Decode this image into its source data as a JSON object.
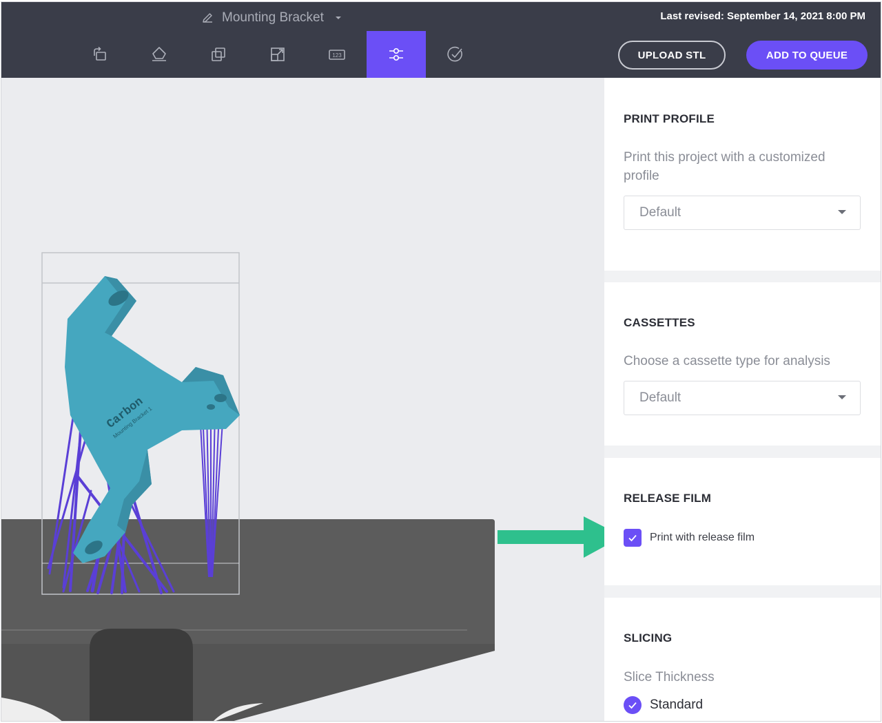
{
  "header": {
    "project_title": "Mounting Bracket",
    "last_revised": "Last revised: September 14, 2021 8:00 PM",
    "upload_label": "UPLOAD STL",
    "queue_label": "ADD TO QUEUE"
  },
  "toolbar": {
    "tools": [
      {
        "name": "orient-icon",
        "active": false
      },
      {
        "name": "platform-icon",
        "active": false
      },
      {
        "name": "duplicate-icon",
        "active": false
      },
      {
        "name": "scale-icon",
        "active": false
      },
      {
        "name": "numbering-icon",
        "active": false,
        "text": "123"
      },
      {
        "name": "settings-sliders-icon",
        "active": true
      },
      {
        "name": "check-circle-icon",
        "active": false
      }
    ]
  },
  "viewport": {
    "part_label": "Carbon",
    "part_sublabel": "Mounting Bracket 1"
  },
  "panel": {
    "print_profile": {
      "title": "PRINT PROFILE",
      "description": "Print this project with a customized profile",
      "selected": "Default"
    },
    "cassettes": {
      "title": "CASSETTES",
      "description": "Choose a cassette type for analysis",
      "selected": "Default"
    },
    "release_film": {
      "title": "RELEASE FILM",
      "checkbox_label": "Print with release film",
      "checked": true
    },
    "slicing": {
      "title": "SLICING",
      "subtitle": "Slice Thickness",
      "option_label": "Standard",
      "selected": true
    }
  },
  "colors": {
    "accent": "#6b4ff6",
    "topbar": "#3a3d49",
    "part": "#45a7bf",
    "supports": "#5a3fd6",
    "arrow": "#2ec08d"
  }
}
